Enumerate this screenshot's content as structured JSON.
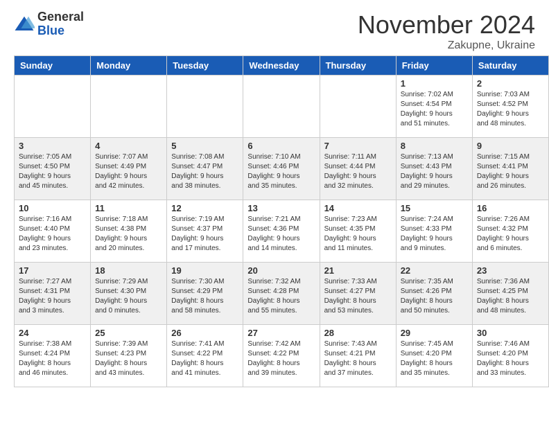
{
  "header": {
    "logo_general": "General",
    "logo_blue": "Blue",
    "month_title": "November 2024",
    "location": "Zakupne, Ukraine"
  },
  "weekdays": [
    "Sunday",
    "Monday",
    "Tuesday",
    "Wednesday",
    "Thursday",
    "Friday",
    "Saturday"
  ],
  "weeks": [
    [
      {
        "day": "",
        "info": ""
      },
      {
        "day": "",
        "info": ""
      },
      {
        "day": "",
        "info": ""
      },
      {
        "day": "",
        "info": ""
      },
      {
        "day": "",
        "info": ""
      },
      {
        "day": "1",
        "info": "Sunrise: 7:02 AM\nSunset: 4:54 PM\nDaylight: 9 hours\nand 51 minutes."
      },
      {
        "day": "2",
        "info": "Sunrise: 7:03 AM\nSunset: 4:52 PM\nDaylight: 9 hours\nand 48 minutes."
      }
    ],
    [
      {
        "day": "3",
        "info": "Sunrise: 7:05 AM\nSunset: 4:50 PM\nDaylight: 9 hours\nand 45 minutes."
      },
      {
        "day": "4",
        "info": "Sunrise: 7:07 AM\nSunset: 4:49 PM\nDaylight: 9 hours\nand 42 minutes."
      },
      {
        "day": "5",
        "info": "Sunrise: 7:08 AM\nSunset: 4:47 PM\nDaylight: 9 hours\nand 38 minutes."
      },
      {
        "day": "6",
        "info": "Sunrise: 7:10 AM\nSunset: 4:46 PM\nDaylight: 9 hours\nand 35 minutes."
      },
      {
        "day": "7",
        "info": "Sunrise: 7:11 AM\nSunset: 4:44 PM\nDaylight: 9 hours\nand 32 minutes."
      },
      {
        "day": "8",
        "info": "Sunrise: 7:13 AM\nSunset: 4:43 PM\nDaylight: 9 hours\nand 29 minutes."
      },
      {
        "day": "9",
        "info": "Sunrise: 7:15 AM\nSunset: 4:41 PM\nDaylight: 9 hours\nand 26 minutes."
      }
    ],
    [
      {
        "day": "10",
        "info": "Sunrise: 7:16 AM\nSunset: 4:40 PM\nDaylight: 9 hours\nand 23 minutes."
      },
      {
        "day": "11",
        "info": "Sunrise: 7:18 AM\nSunset: 4:38 PM\nDaylight: 9 hours\nand 20 minutes."
      },
      {
        "day": "12",
        "info": "Sunrise: 7:19 AM\nSunset: 4:37 PM\nDaylight: 9 hours\nand 17 minutes."
      },
      {
        "day": "13",
        "info": "Sunrise: 7:21 AM\nSunset: 4:36 PM\nDaylight: 9 hours\nand 14 minutes."
      },
      {
        "day": "14",
        "info": "Sunrise: 7:23 AM\nSunset: 4:35 PM\nDaylight: 9 hours\nand 11 minutes."
      },
      {
        "day": "15",
        "info": "Sunrise: 7:24 AM\nSunset: 4:33 PM\nDaylight: 9 hours\nand 9 minutes."
      },
      {
        "day": "16",
        "info": "Sunrise: 7:26 AM\nSunset: 4:32 PM\nDaylight: 9 hours\nand 6 minutes."
      }
    ],
    [
      {
        "day": "17",
        "info": "Sunrise: 7:27 AM\nSunset: 4:31 PM\nDaylight: 9 hours\nand 3 minutes."
      },
      {
        "day": "18",
        "info": "Sunrise: 7:29 AM\nSunset: 4:30 PM\nDaylight: 9 hours\nand 0 minutes."
      },
      {
        "day": "19",
        "info": "Sunrise: 7:30 AM\nSunset: 4:29 PM\nDaylight: 8 hours\nand 58 minutes."
      },
      {
        "day": "20",
        "info": "Sunrise: 7:32 AM\nSunset: 4:28 PM\nDaylight: 8 hours\nand 55 minutes."
      },
      {
        "day": "21",
        "info": "Sunrise: 7:33 AM\nSunset: 4:27 PM\nDaylight: 8 hours\nand 53 minutes."
      },
      {
        "day": "22",
        "info": "Sunrise: 7:35 AM\nSunset: 4:26 PM\nDaylight: 8 hours\nand 50 minutes."
      },
      {
        "day": "23",
        "info": "Sunrise: 7:36 AM\nSunset: 4:25 PM\nDaylight: 8 hours\nand 48 minutes."
      }
    ],
    [
      {
        "day": "24",
        "info": "Sunrise: 7:38 AM\nSunset: 4:24 PM\nDaylight: 8 hours\nand 46 minutes."
      },
      {
        "day": "25",
        "info": "Sunrise: 7:39 AM\nSunset: 4:23 PM\nDaylight: 8 hours\nand 43 minutes."
      },
      {
        "day": "26",
        "info": "Sunrise: 7:41 AM\nSunset: 4:22 PM\nDaylight: 8 hours\nand 41 minutes."
      },
      {
        "day": "27",
        "info": "Sunrise: 7:42 AM\nSunset: 4:22 PM\nDaylight: 8 hours\nand 39 minutes."
      },
      {
        "day": "28",
        "info": "Sunrise: 7:43 AM\nSunset: 4:21 PM\nDaylight: 8 hours\nand 37 minutes."
      },
      {
        "day": "29",
        "info": "Sunrise: 7:45 AM\nSunset: 4:20 PM\nDaylight: 8 hours\nand 35 minutes."
      },
      {
        "day": "30",
        "info": "Sunrise: 7:46 AM\nSunset: 4:20 PM\nDaylight: 8 hours\nand 33 minutes."
      }
    ]
  ]
}
